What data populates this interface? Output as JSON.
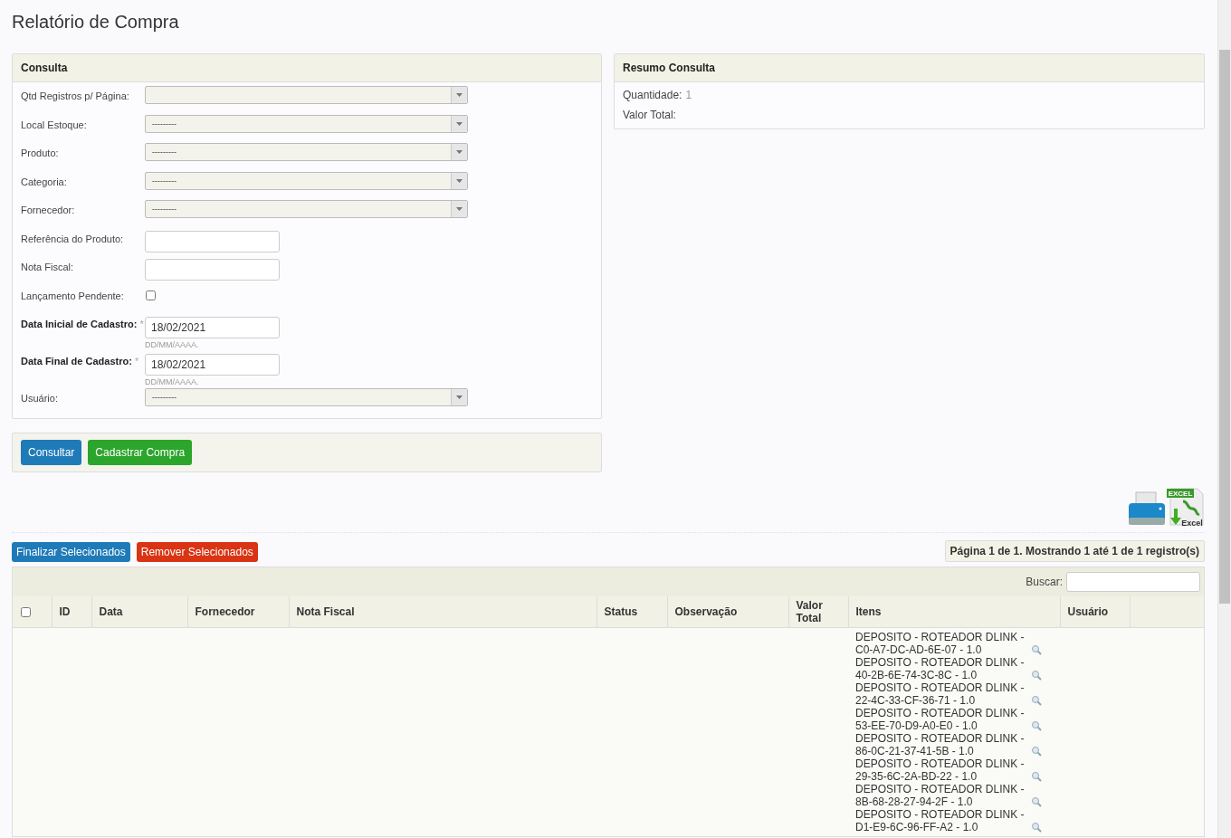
{
  "page_title": "Relatório de Compra",
  "consulta": {
    "title": "Consulta",
    "fields": [
      {
        "kind": "select",
        "label": "Qtd Registros p/ Página:"
      },
      {
        "kind": "select",
        "label": "Local Estoque:",
        "value": "---------"
      },
      {
        "kind": "select",
        "label": "Produto:",
        "value": "---------"
      },
      {
        "kind": "select",
        "label": "Categoria:",
        "value": "---------"
      },
      {
        "kind": "select",
        "label": "Fornecedor:",
        "value": "---------"
      },
      {
        "kind": "text",
        "label": "Referência do Produto:"
      },
      {
        "kind": "text",
        "label": "Nota Fiscal:"
      },
      {
        "kind": "checkbox",
        "label": "Lançamento Pendente:",
        "checked": false
      },
      {
        "kind": "date",
        "label": "Data Inicial de Cadastro:",
        "required_mark": "*",
        "value": "18/02/2021",
        "hint": "DD/MM/AAAA."
      },
      {
        "kind": "date",
        "label": "Data Final de Cadastro:",
        "required_mark": "*",
        "value": "18/02/2021",
        "hint": "DD/MM/AAAA."
      },
      {
        "kind": "select",
        "label": "Usuário:",
        "value": "---------"
      }
    ]
  },
  "actions": [
    "Consultar",
    "Cadastrar Compra"
  ],
  "resumo": {
    "title": "Resumo Consulta",
    "rows": [
      {
        "label": "Quantidade:",
        "value": "1"
      },
      {
        "label": "Valor Total:"
      }
    ]
  },
  "export_icons": {
    "excel_label": "EXCEL",
    "excel_sub": "Excel"
  },
  "bulk_actions": [
    "Finalizar Selecionados",
    "Remover Selecionados"
  ],
  "pagination": "Página 1 de 1. Mostrando 1 até 1 de 1 registro(s)",
  "search_label": "Buscar:",
  "table": {
    "select_all_checked": false,
    "columns": [
      "ID",
      "Data",
      "Fornecedor",
      "Nota Fiscal",
      "Status",
      "Observação",
      "Valor Total",
      "Itens",
      "Usuário"
    ],
    "items": [
      "DEPOSITO - ROTEADOR DLINK - C0-A7-DC-AD-6E-07 - 1.0",
      "DEPOSITO - ROTEADOR DLINK - 40-2B-6E-74-3C-8C - 1.0",
      "DEPOSITO - ROTEADOR DLINK - 22-4C-33-CF-36-71 - 1.0",
      "DEPOSITO - ROTEADOR DLINK - 53-EE-70-D9-A0-E0 - 1.0",
      "DEPOSITO - ROTEADOR DLINK - 86-0C-21-37-41-5B - 1.0",
      "DEPOSITO - ROTEADOR DLINK - 29-35-6C-2A-BD-22 - 1.0",
      "DEPOSITO - ROTEADOR DLINK - 8B-68-28-27-94-2F - 1.0",
      "DEPOSITO - ROTEADOR DLINK - D1-E9-6C-96-FF-A2 - 1.0"
    ]
  }
}
